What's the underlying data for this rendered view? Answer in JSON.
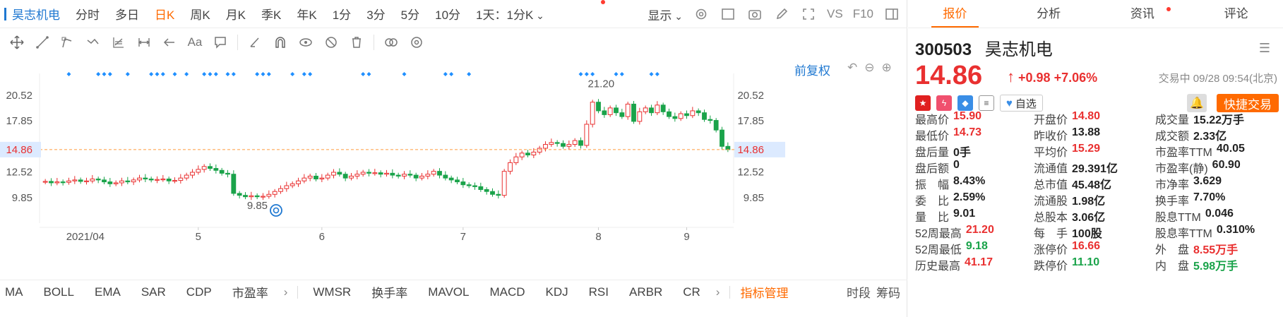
{
  "colors": {
    "accent": "#ff6a00",
    "link": "#1f78d1",
    "up": "#e93030",
    "down": "#1aa34a"
  },
  "topbar": {
    "stock_name": "昊志机电",
    "periods": [
      "分时",
      "多日",
      "日K",
      "周K",
      "月K",
      "季K",
      "年K",
      "1分",
      "3分",
      "5分",
      "10分"
    ],
    "active_period": "日K",
    "interval_select": "1天：1分K",
    "display_label": "显示",
    "vs_label": "VS",
    "f10_label": "F10"
  },
  "chart": {
    "fq_label": "前复权",
    "price_label": "14.86",
    "high_annot": "21.20",
    "low_annot": "9.85",
    "y_ticks": [
      "20.52",
      "17.85",
      "14.86",
      "12.52",
      "9.85"
    ],
    "x_ticks": [
      "2021/04",
      "5",
      "6",
      "7",
      "8",
      "9"
    ]
  },
  "chart_data": {
    "type": "candlestick",
    "ylim": [
      7.5,
      22.5
    ],
    "current_price": 14.86,
    "y_ticks": [
      20.52,
      17.85,
      14.86,
      12.52,
      9.85
    ],
    "x_ticks": [
      "2021/04",
      "5",
      "6",
      "7",
      "8",
      "9"
    ],
    "high_annotation": 21.2,
    "low_annotation": 9.85,
    "closes": [
      11.55,
      11.4,
      11.5,
      11.45,
      11.6,
      11.7,
      11.55,
      11.6,
      11.8,
      11.7,
      11.5,
      11.3,
      11.4,
      11.6,
      11.5,
      11.7,
      11.9,
      11.8,
      11.7,
      11.75,
      11.8,
      11.6,
      11.65,
      11.9,
      12.2,
      12.5,
      12.8,
      13.1,
      12.9,
      12.7,
      12.4,
      12.3,
      10.3,
      10.1,
      9.95,
      10.05,
      9.95,
      10.0,
      10.2,
      10.5,
      10.8,
      11.1,
      11.3,
      11.6,
      11.9,
      12.1,
      11.8,
      11.9,
      12.2,
      12.5,
      12.3,
      11.9,
      12.1,
      12.3,
      12.5,
      12.4,
      12.45,
      12.3,
      12.4,
      12.2,
      12.1,
      12.3,
      12.2,
      11.9,
      12.1,
      12.3,
      12.6,
      12.2,
      11.9,
      11.7,
      11.5,
      11.2,
      11.1,
      11.0,
      10.7,
      10.5,
      10.2,
      10.1,
      12.6,
      13.5,
      14.1,
      14.5,
      14.3,
      14.6,
      15.0,
      15.4,
      15.6,
      15.5,
      15.2,
      15.4,
      15.8,
      15.3,
      17.5,
      19.8,
      18.9,
      18.5,
      19.2,
      18.7,
      18.3,
      19.6,
      17.8,
      18.8,
      19.2,
      18.7,
      19.5,
      18.8,
      18.3,
      18.1,
      18.6,
      18.4,
      18.9,
      18.7,
      18.0,
      17.9,
      16.9,
      15.2,
      14.86
    ],
    "markers": [
      4,
      9,
      10,
      11,
      14,
      18,
      19,
      20,
      22,
      24,
      27,
      28,
      29,
      31,
      32,
      36,
      37,
      38,
      42,
      44,
      45,
      54,
      55,
      61,
      68,
      69,
      72,
      91,
      92,
      93,
      97,
      98,
      103,
      104
    ]
  },
  "toolbar": {
    "icons": [
      "move-icon",
      "line-icon",
      "polyline-icon",
      "wave-icon",
      "fib-icon",
      "measure-icon",
      "arrow-left-icon",
      "text-icon",
      "note-icon",
      "brush-icon",
      "magnet-icon",
      "eye-icon",
      "hide-icon",
      "trash-icon",
      "link-icon",
      "settings-icon"
    ]
  },
  "indicators": {
    "items": [
      "MA",
      "BOLL",
      "EMA",
      "SAR",
      "CDP",
      "市盈率",
      "WMSR",
      "换手率",
      "MAVOL",
      "MACD",
      "KDJ",
      "RSI",
      "ARBR",
      "CR"
    ],
    "manage_label": "指标管理",
    "end_tabs": [
      "时段",
      "筹码"
    ]
  },
  "quote": {
    "tabs": [
      "报价",
      "分析",
      "资讯",
      "评论"
    ],
    "code": "300503",
    "name": "昊志机电",
    "price": "14.86",
    "change": "+0.98",
    "change_pct": "+7.06%",
    "trade_time": "交易中 09/28 09:54(北京)",
    "fav_label": "自选",
    "quick_trade_label": "快捷交易",
    "stats": [
      [
        {
          "l": "最高价",
          "v": "15.90",
          "c": "red"
        },
        {
          "l": "开盘价",
          "v": "14.80",
          "c": "red"
        },
        {
          "l": "成交量",
          "v": "15.22万手",
          "c": ""
        }
      ],
      [
        {
          "l": "最低价",
          "v": "14.73",
          "c": "red"
        },
        {
          "l": "昨收价",
          "v": "13.88",
          "c": ""
        },
        {
          "l": "成交额",
          "v": "2.33亿",
          "c": ""
        }
      ],
      [
        {
          "l": "盘后量",
          "v": "0手",
          "c": ""
        },
        {
          "l": "平均价",
          "v": "15.29",
          "c": "red"
        },
        {
          "l": "市盈率TTM",
          "v": "40.05",
          "c": ""
        }
      ],
      [
        {
          "l": "盘后额",
          "v": "0",
          "c": ""
        },
        {
          "l": "流通值",
          "v": "29.391亿",
          "c": ""
        },
        {
          "l": "市盈率(静)",
          "v": "60.90",
          "c": ""
        }
      ],
      [
        {
          "l": "振　幅",
          "v": "8.43%",
          "c": ""
        },
        {
          "l": "总市值",
          "v": "45.48亿",
          "c": ""
        },
        {
          "l": "市净率",
          "v": "3.629",
          "c": ""
        }
      ],
      [
        {
          "l": "委　比",
          "v": "2.59%",
          "c": ""
        },
        {
          "l": "流通股",
          "v": "1.98亿",
          "c": ""
        },
        {
          "l": "换手率",
          "v": "7.70%",
          "c": ""
        }
      ],
      [
        {
          "l": "量　比",
          "v": "9.01",
          "c": ""
        },
        {
          "l": "总股本",
          "v": "3.06亿",
          "c": ""
        },
        {
          "l": "股息TTM",
          "v": "0.046",
          "c": ""
        }
      ],
      [
        {
          "l": "52周最高",
          "v": "21.20",
          "c": "red"
        },
        {
          "l": "每　手",
          "v": "100股",
          "c": ""
        },
        {
          "l": "股息率TTM",
          "v": "0.310%",
          "c": ""
        }
      ],
      [
        {
          "l": "52周最低",
          "v": "9.18",
          "c": "green"
        },
        {
          "l": "涨停价",
          "v": "16.66",
          "c": "red"
        },
        {
          "l": "外　盘",
          "v": "8.55万手",
          "c": "red"
        }
      ],
      [
        {
          "l": "历史最高",
          "v": "41.17",
          "c": "red"
        },
        {
          "l": "跌停价",
          "v": "11.10",
          "c": "green"
        },
        {
          "l": "内　盘",
          "v": "5.98万手",
          "c": "green"
        }
      ]
    ]
  }
}
